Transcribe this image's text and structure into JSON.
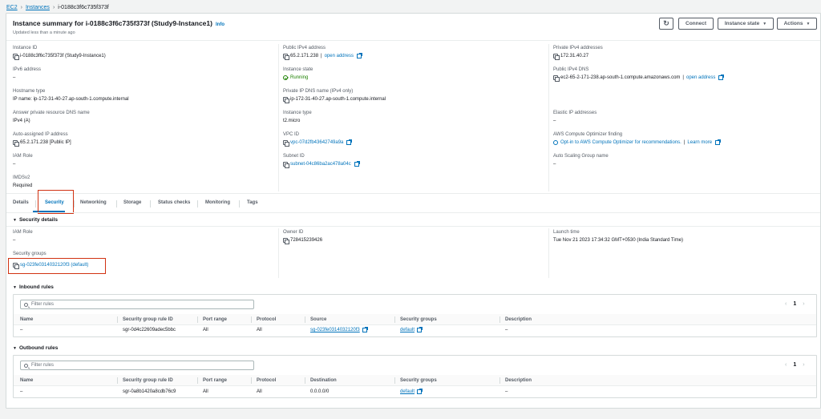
{
  "breadcrumb": [
    "EC2",
    "Instances",
    "i-0188c3f6c735f373f"
  ],
  "header": {
    "title": "Instance summary for i-0188c3f6c735f373f (Study9-Instance1)",
    "info": "Info",
    "updated": "Updated less than a minute ago",
    "connect": "Connect",
    "instance_state": "Instance state",
    "actions": "Actions"
  },
  "summary": {
    "instance_id_label": "Instance ID",
    "instance_id": "i-0188c3f6c735f373f (Study9-Instance1)",
    "public_ipv4_label": "Public IPv4 address",
    "public_ipv4": "65.2.171.238",
    "open_address": "open address",
    "private_ipv4_label": "Private IPv4 addresses",
    "private_ipv4": "172.31.40.27",
    "ipv6_label": "IPv6 address",
    "ipv6": "–",
    "instance_state_label": "Instance state",
    "instance_state": "Running",
    "public_dns_label": "Public IPv4 DNS",
    "public_dns": "ec2-65-2-171-238.ap-south-1.compute.amazonaws.com",
    "hostname_type_label": "Hostname type",
    "hostname_type": "IP name: ip-172-31-40-27.ap-south-1.compute.internal",
    "private_dns_label": "Private IP DNS name (IPv4 only)",
    "private_dns": "ip-172-31-40-27.ap-south-1.compute.internal",
    "answer_dns_label": "Answer private resource DNS name",
    "answer_dns": "IPv4 (A)",
    "instance_type_label": "Instance type",
    "instance_type": "t2.micro",
    "elastic_ip_label": "Elastic IP addresses",
    "elastic_ip": "–",
    "auto_ip_label": "Auto-assigned IP address",
    "auto_ip": "65.2.171.238 [Public IP]",
    "vpc_label": "VPC ID",
    "vpc": "vpc-07d2fb43642749a9a",
    "optimizer_label": "AWS Compute Optimizer finding",
    "optimizer": "Opt-in to AWS Compute Optimizer for recommendations.",
    "learn_more": "Learn more",
    "iam_role_label": "IAM Role",
    "iam_role": "–",
    "subnet_label": "Subnet ID",
    "subnet": "subnet-04c86ba2ac478a04c",
    "asg_label": "Auto Scaling Group name",
    "asg": "–",
    "imds_label": "IMDSv2",
    "imds": "Required"
  },
  "tabs": [
    "Details",
    "Security",
    "Networking",
    "Storage",
    "Status checks",
    "Monitoring",
    "Tags"
  ],
  "security": {
    "heading": "Security details",
    "iam_role_label": "IAM Role",
    "iam_role": "–",
    "owner_label": "Owner ID",
    "owner": "728415239426",
    "launch_label": "Launch time",
    "launch": "Tue Nov 21 2023 17:34:32 GMT+0530 (India Standard Time)",
    "sg_label": "Security groups",
    "sg": "sg-023fe0314032120f3 (default)"
  },
  "inbound": {
    "heading": "Inbound rules",
    "filter_placeholder": "Filter rules",
    "page": "1",
    "columns": [
      "Name",
      "Security group rule ID",
      "Port range",
      "Protocol",
      "Source",
      "Security groups",
      "Description"
    ],
    "row": [
      "–",
      "sgr-0d4c22609adec5bbc",
      "All",
      "All",
      "sg-023fe0314032120f3",
      "default",
      "–"
    ]
  },
  "outbound": {
    "heading": "Outbound rules",
    "filter_placeholder": "Filter rules",
    "page": "1",
    "columns": [
      "Name",
      "Security group rule ID",
      "Port range",
      "Protocol",
      "Destination",
      "Security groups",
      "Description"
    ],
    "row": [
      "–",
      "sgr-0a8b1420a8cdb76c9",
      "All",
      "All",
      "0.0.0.0/0",
      "default",
      "–"
    ]
  },
  "colors": {
    "link": "#0073bb",
    "running": "#1d8102",
    "highlight": "#d13212"
  }
}
